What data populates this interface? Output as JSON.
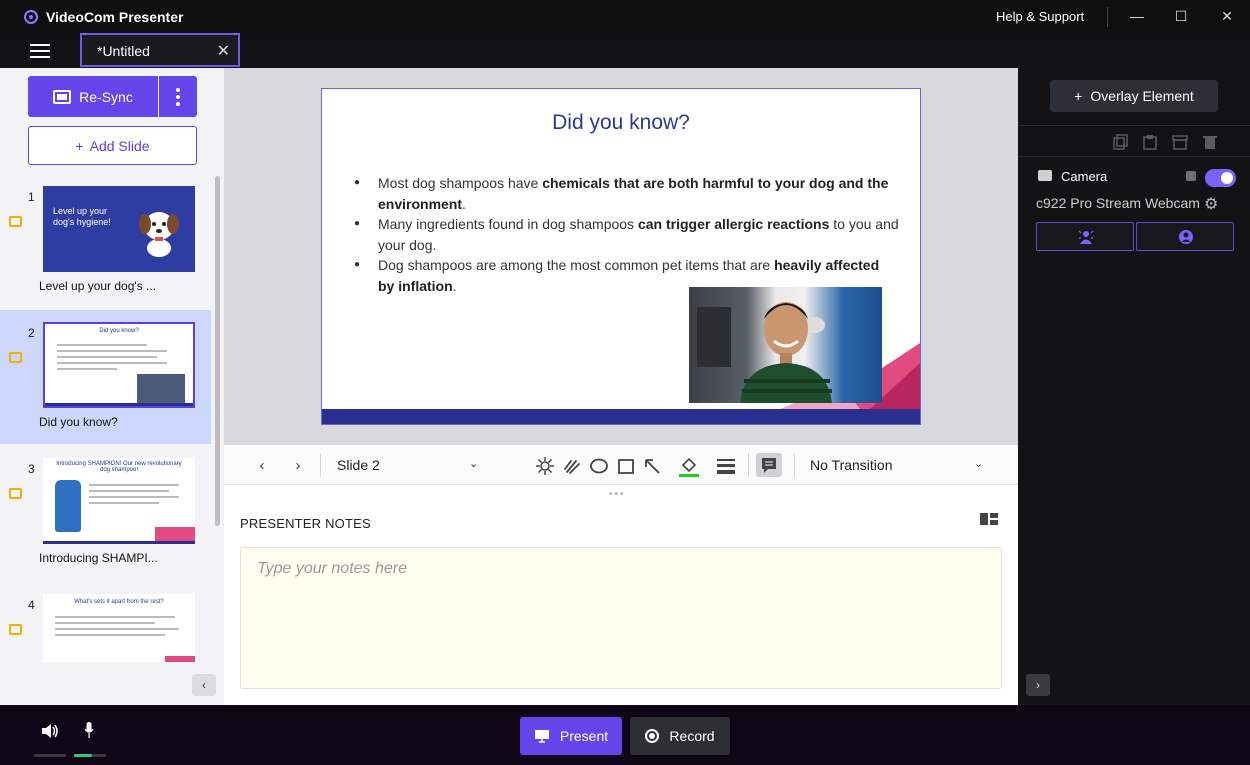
{
  "app": {
    "title": "VideoCom Presenter",
    "help": "Help & Support"
  },
  "window": {
    "minimize": "—",
    "maximize": "☐",
    "close": "✕"
  },
  "tab": {
    "name": "*Untitled",
    "close": "✕"
  },
  "sidebar": {
    "resync_label": "Re-Sync",
    "add_slide_label": "Add Slide",
    "collapse": "‹",
    "slides": [
      {
        "num": "1",
        "caption": "Level up your dog's ...",
        "thumb_title": "Level up your dog's hygiene!"
      },
      {
        "num": "2",
        "caption": "Did you know?",
        "thumb_title": "Did you know?"
      },
      {
        "num": "3",
        "caption": "Introducing SHAMPI...",
        "thumb_title": "Introducing SHAMPION! Our new revolutionary dog shampoo!"
      },
      {
        "num": "4",
        "caption": "",
        "thumb_title": "What's sets it apart from the rest?"
      }
    ]
  },
  "slide": {
    "title": "Did you know?",
    "bullets": [
      {
        "pre": "Most dog shampoos have ",
        "bold": "chemicals that are both harmful to your dog and the environment",
        "post": "."
      },
      {
        "pre": "Many ingredients found in dog shampoos ",
        "bold": "can trigger allergic reactions",
        "post": " to you and your dog."
      },
      {
        "pre": "Dog shampoos are among the most common pet items that are ",
        "bold": "heavily affected by inflation",
        "post": "."
      }
    ]
  },
  "toolbar": {
    "prev": "‹",
    "next": "›",
    "slide_select": "Slide 2",
    "transition": "No Transition",
    "chevron": "⌄",
    "colors": {
      "fill_accent": "#22cc22"
    }
  },
  "notes": {
    "label": "PRESENTER NOTES",
    "placeholder": "Type your notes here",
    "dots": "•••"
  },
  "right": {
    "overlay_label": "Overlay Element",
    "overlay_plus": "+",
    "camera_label": "Camera",
    "webcam_name": "c922 Pro Stream Webcam",
    "expand": "›"
  },
  "bottom": {
    "present_label": "Present",
    "record_label": "Record",
    "mic_level": 0.55
  },
  "colors": {
    "accent": "#6246ea",
    "active_slide": "#ccd7fb"
  }
}
